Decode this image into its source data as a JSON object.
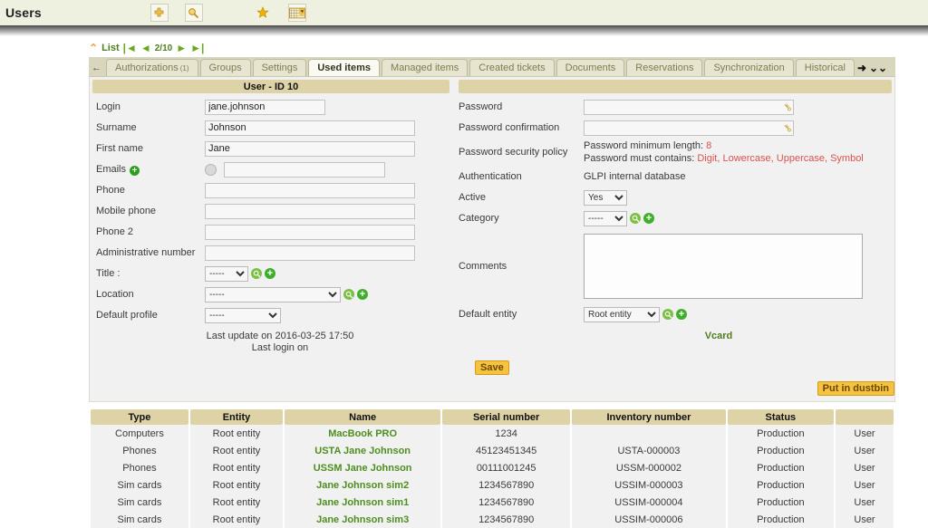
{
  "topbar": {
    "title": "Users",
    "icons": [
      {
        "name": "add-icon",
        "glyph": "✚"
      },
      {
        "name": "search-icon",
        "glyph": "🔍"
      },
      {
        "name": "bookmark-star-icon",
        "glyph": "★"
      },
      {
        "name": "list-view-icon",
        "glyph": "▦"
      }
    ]
  },
  "breadcrumb": {
    "up_glyph": "⌃",
    "list_label": "List",
    "first_glyph": "|◄",
    "prev_glyph": "◄",
    "counter": "2/10",
    "next_glyph": "►",
    "last_glyph": "►|"
  },
  "tabs": {
    "back_glyph": "←",
    "items": [
      {
        "label": "Authorizations",
        "sup": "(1)",
        "active": false
      },
      {
        "label": "Groups",
        "sup": "",
        "active": false
      },
      {
        "label": "Settings",
        "sup": "",
        "active": false
      },
      {
        "label": "Used items",
        "sup": "",
        "active": true
      },
      {
        "label": "Managed items",
        "sup": "",
        "active": false
      },
      {
        "label": "Created tickets",
        "sup": "",
        "active": false
      },
      {
        "label": "Documents",
        "sup": "",
        "active": false
      },
      {
        "label": "Reservations",
        "sup": "",
        "active": false
      },
      {
        "label": "Synchronization",
        "sup": "",
        "active": false
      },
      {
        "label": "Historical",
        "sup": "",
        "active": false
      }
    ],
    "forward_glyph": "➜",
    "more_glyph": "⌄⌄"
  },
  "form": {
    "header_left": "User - ID 10",
    "header_right": "",
    "left": {
      "login_label": "Login",
      "login_value": "jane.johnson",
      "surname_label": "Surname",
      "surname_value": "Johnson",
      "firstname_label": "First name",
      "firstname_value": "Jane",
      "emails_label": "Emails",
      "emails_value": "",
      "phone_label": "Phone",
      "phone_value": "",
      "mobile_label": "Mobile phone",
      "mobile_value": "",
      "phone2_label": "Phone 2",
      "phone2_value": "",
      "admnum_label": "Administrative number",
      "admnum_value": "",
      "title_label": "Title :",
      "title_value": "-----",
      "location_label": "Location",
      "location_value": "-----",
      "profile_label": "Default profile",
      "profile_value": "-----",
      "last_update": "Last update on 2016-03-25 17:50",
      "last_login": "Last login on"
    },
    "right": {
      "password_label": "Password",
      "password_value": "",
      "password_conf_label": "Password confirmation",
      "password_conf_value": "",
      "policy_label": "Password security policy",
      "policy_minlen_text": "Password minimum length: ",
      "policy_minlen_value": "8",
      "policy_contains_text": "Password must contains: ",
      "policy_contains_value": "Digit, Lowercase, Uppercase, Symbol",
      "auth_label": "Authentication",
      "auth_value": "GLPI internal database",
      "active_label": "Active",
      "active_value": "Yes",
      "category_label": "Category",
      "category_value": "-----",
      "comments_label": "Comments",
      "comments_value": "",
      "entity_label": "Default entity",
      "entity_value": "Root entity",
      "vcard_label": "Vcard"
    },
    "save_label": "Save",
    "dustbin_label": "Put in dustbin"
  },
  "table": {
    "headers": [
      "Type",
      "Entity",
      "Name",
      "Serial number",
      "Inventory number",
      "Status",
      ""
    ],
    "rows": [
      {
        "type": "Computers",
        "entity": "Root entity",
        "name": "MacBook PRO",
        "serial": "1234",
        "inventory": "",
        "status": "Production",
        "last": "User"
      },
      {
        "type": "Phones",
        "entity": "Root entity",
        "name": "USTA Jane Johnson",
        "serial": "45123451345",
        "inventory": "USTA-000003",
        "status": "Production",
        "last": "User"
      },
      {
        "type": "Phones",
        "entity": "Root entity",
        "name": "USSM Jane Johnson",
        "serial": "00111001245",
        "inventory": "USSM-000002",
        "status": "Production",
        "last": "User"
      },
      {
        "type": "Sim cards",
        "entity": "Root entity",
        "name": "Jane Johnson sim2",
        "serial": "1234567890",
        "inventory": "USSIM-000003",
        "status": "Production",
        "last": "User"
      },
      {
        "type": "Sim cards",
        "entity": "Root entity",
        "name": "Jane Johnson sim1",
        "serial": "1234567890",
        "inventory": "USSIM-000004",
        "status": "Production",
        "last": "User"
      },
      {
        "type": "Sim cards",
        "entity": "Root entity",
        "name": "Jane Johnson sim3",
        "serial": "1234567890",
        "inventory": "USSIM-000006",
        "status": "Production",
        "last": "User"
      }
    ]
  },
  "colors": {
    "header_bg": "#eef0e0",
    "band": "#ddd3a6",
    "accent_green": "#4d7d1f",
    "button": "#f5c242",
    "alert_red": "#d9534f"
  }
}
